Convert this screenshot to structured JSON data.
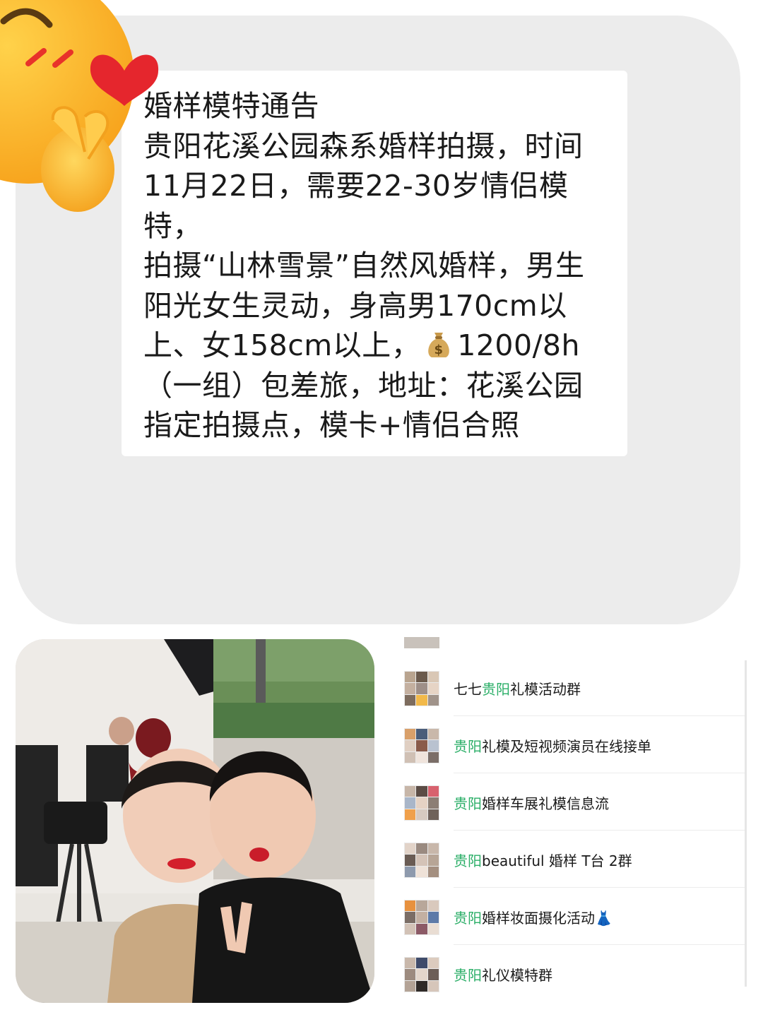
{
  "notice": {
    "lines": [
      "婚样模特通告",
      "贵阳花溪公园森系婚样拍摄，时间",
      "11月22日，需要22-30岁情侣模",
      "特，",
      "拍摄“山林雪景”自然风婚样，男生",
      "阳光女生灵动，身高男170cm以",
      "上、女158cm以上，",
      "（一组）包差旅，地址：花溪公园",
      "指定拍摄点，模卡+情侣合照"
    ],
    "price": "1200/8h",
    "price_icon": "money-bag-icon"
  },
  "sticker": {
    "icon": "blush-kiss-heart-icon"
  },
  "groups": [
    {
      "highlight": "",
      "prefix": "七七",
      "highlight_mid": "贵阳",
      "suffix": "礼模活动群"
    },
    {
      "prefix": "",
      "highlight_mid": "贵阳",
      "suffix": "礼模及短视频演员在线接单"
    },
    {
      "prefix": "",
      "highlight_mid": "贵阳",
      "suffix": "婚样车展礼模信息流"
    },
    {
      "prefix": "",
      "highlight_mid": "贵阳",
      "suffix": "beautiful 婚样 T台 2群"
    },
    {
      "prefix": "",
      "highlight_mid": "贵阳",
      "suffix": "婚样妆面摄化活动👗"
    },
    {
      "prefix": "",
      "highlight_mid": "贵阳",
      "suffix": "礼仪模特群"
    }
  ],
  "colors": {
    "highlight": "#2aae67",
    "panel": "#ececec"
  }
}
